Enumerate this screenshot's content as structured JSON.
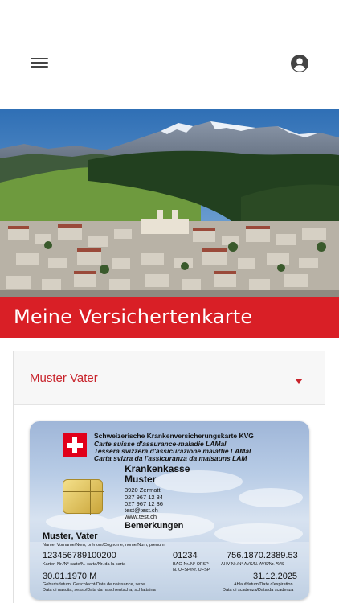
{
  "header": {
    "menu_icon": "hamburger-menu-icon",
    "account_icon": "account-circle-icon"
  },
  "page": {
    "title": "Meine Versichertenkarte"
  },
  "selector": {
    "selected": "Muster Vater"
  },
  "card": {
    "heading_de": "Schweizerische Krankenversicherungskarte KVG",
    "heading_fr": "Carte suisse d'assurance-maladie LAMal",
    "heading_it": "Tessera svizzera d'assicurazione malattie LAMal",
    "heading_rm": "Carta svizra da l'assicuranza da malsauns LAM",
    "insurer_line1": "Krankenkasse",
    "insurer_line2": "Muster",
    "address_city": "3920 Zermatt",
    "phone1": "027 967 12 34",
    "phone2": "027 967 12 36",
    "email": "test@test.ch",
    "web": "www.test.ch",
    "remarks_label": "Bemerkungen",
    "holder_name": "Muster, Vater",
    "holder_name_caption": "Name, Vorname/Nom, prénom/Cognome, nome/Num, prenum",
    "card_number": "123456789100200",
    "card_number_caption": "Karten-Nr./N° carte/N. carta/Nr. da la carta",
    "bag_number": "01234",
    "bag_caption1": "BAG-Nr./N° OFSP",
    "bag_caption2": "N. UFSP/Nr. UFSP",
    "ahv_number": "756.1870.2389.53",
    "ahv_caption": "AHV-Nr./N° AVS/N. AVS/Nr. AVS",
    "birth_info": "30.01.1970 M",
    "birth_caption1": "Geburtsdatum, Geschlecht/Date de naissance, sexe",
    "birth_caption2": "Data di nascita, sesso/Data da naschientscha, schlattaina",
    "expiry": "31.12.2025",
    "expiry_caption1": "Ablaufdatum/Date d'expiration",
    "expiry_caption2": "Data di scadenza/Data da scadenza"
  }
}
